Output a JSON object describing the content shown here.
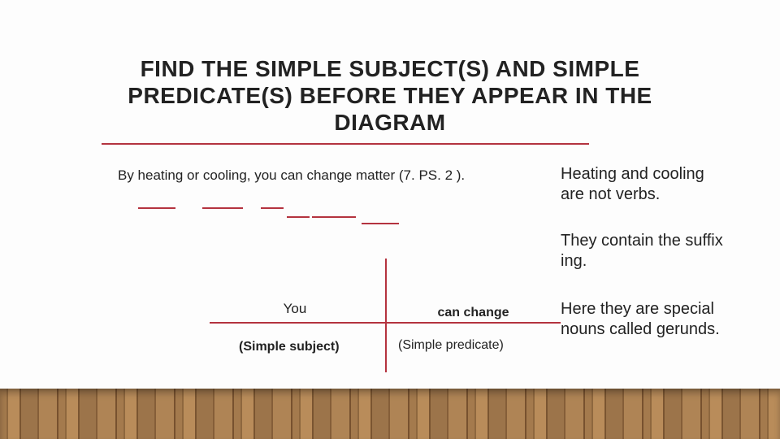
{
  "title": "FIND THE SIMPLE SUBJECT(S) AND SIMPLE PREDICATE(S) BEFORE THEY APPEAR IN THE DIAGRAM",
  "sentence": "By heating or cooling, you can change matter (7. PS. 2 ).",
  "notes": {
    "n1": "Heating and cooling are not verbs.",
    "n2": "They contain the suffix ing.",
    "n3": "Here they are special nouns called gerunds."
  },
  "diagram": {
    "subject": "You",
    "predicate": "can change",
    "subject_label": "(Simple subject)",
    "predicate_label": "(Simple predicate)"
  },
  "colors": {
    "accent": "#b4333f"
  }
}
